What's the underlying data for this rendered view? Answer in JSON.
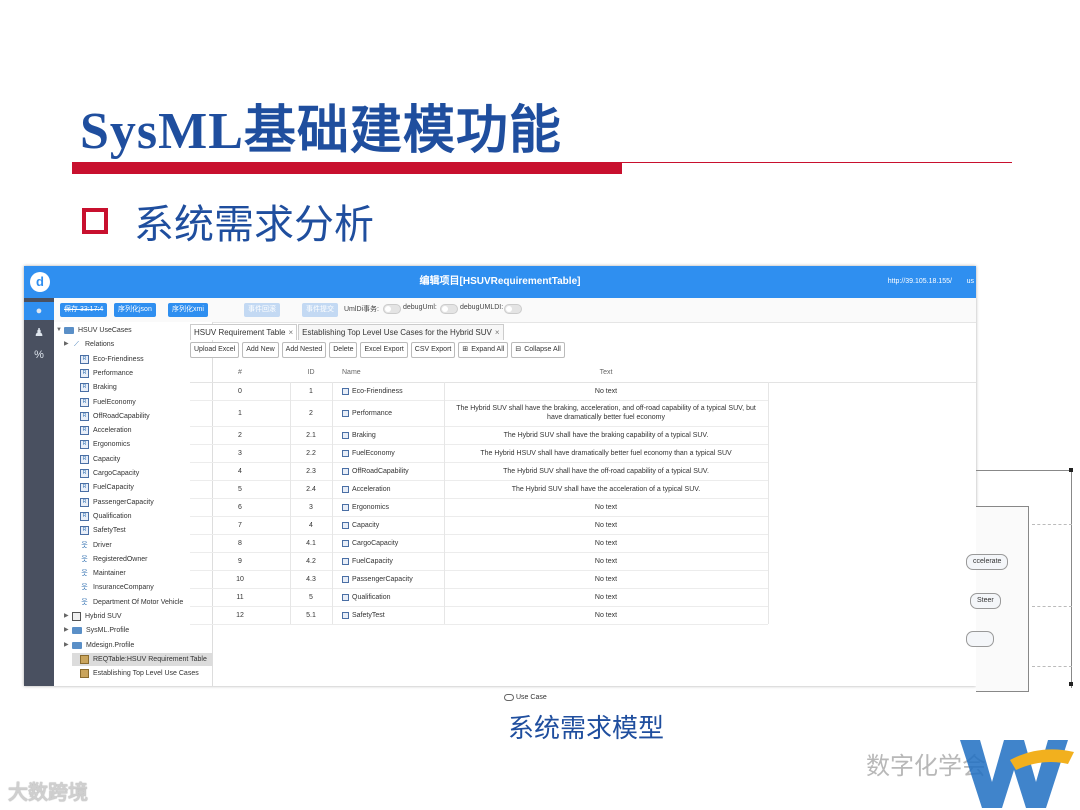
{
  "slide": {
    "title": "SysML基础建模功能",
    "subtitle": "系统需求分析",
    "caption": "系统需求模型",
    "watermark_left": "大数跨境",
    "watermark_right": "数字化学会"
  },
  "app": {
    "logo": "d",
    "window_title": "编辑项目[HSUVRequirementTable]",
    "url": "http://39.105.18.155/",
    "user": "us"
  },
  "toolbar": {
    "save_label": "保存 33:17:4",
    "json_label": "序列化json",
    "xmi_label": "序列化xmi",
    "disabled1": "事件回滚",
    "disabled2": "事件提交",
    "switch1_label": "UmlDi事务:",
    "switch2_label": "debugUml:",
    "switch3_label": "debugUMLDI:"
  },
  "tree": {
    "items": [
      {
        "label": "HSUV UseCases",
        "arrow": "▼",
        "icon": "folder"
      },
      {
        "label": "Relations",
        "arrow": "▶",
        "icon": "rel"
      },
      {
        "label": "Eco-Friendiness",
        "arrow": "",
        "icon": "req"
      },
      {
        "label": "Performance",
        "arrow": "",
        "icon": "req"
      },
      {
        "label": "Braking",
        "arrow": "",
        "icon": "req"
      },
      {
        "label": "FuelEconomy",
        "arrow": "",
        "icon": "req"
      },
      {
        "label": "OffRoadCapability",
        "arrow": "",
        "icon": "req"
      },
      {
        "label": "Acceleration",
        "arrow": "",
        "icon": "req"
      },
      {
        "label": "Ergonomics",
        "arrow": "",
        "icon": "req"
      },
      {
        "label": "Capacity",
        "arrow": "",
        "icon": "req"
      },
      {
        "label": "CargoCapacity",
        "arrow": "",
        "icon": "req"
      },
      {
        "label": "FuelCapacity",
        "arrow": "",
        "icon": "req"
      },
      {
        "label": "PassengerCapacity",
        "arrow": "",
        "icon": "req"
      },
      {
        "label": "Qualification",
        "arrow": "",
        "icon": "req"
      },
      {
        "label": "SafetyTest",
        "arrow": "",
        "icon": "req"
      },
      {
        "label": "Driver",
        "arrow": "",
        "icon": "actor"
      },
      {
        "label": "RegisteredOwner",
        "arrow": "",
        "icon": "actor"
      },
      {
        "label": "Maintainer",
        "arrow": "",
        "icon": "actor"
      },
      {
        "label": "InsuranceCompany",
        "arrow": "",
        "icon": "actor"
      },
      {
        "label": "Department Of Motor Vehicle",
        "arrow": "",
        "icon": "actor"
      },
      {
        "label": "Hybrid SUV",
        "arrow": "▶",
        "icon": "pkg"
      },
      {
        "label": "SysML.Profile",
        "arrow": "▶",
        "icon": "folder"
      },
      {
        "label": "Mdesign.Profile",
        "arrow": "▶",
        "icon": "folder"
      },
      {
        "label": "REQTable:HSUV Requirement Table",
        "arrow": "",
        "icon": "table"
      },
      {
        "label": "Establishing Top Level Use Cases",
        "arrow": "",
        "icon": "table"
      }
    ]
  },
  "tabs": [
    {
      "label": "HSUV Requirement Table",
      "close": "×"
    },
    {
      "label": "Establishing Top Level Use Cases for the Hybrid SUV",
      "close": "×"
    }
  ],
  "actions": [
    {
      "label": "Upload Excel",
      "icon": ""
    },
    {
      "label": "Add New",
      "icon": ""
    },
    {
      "label": "Add Nested",
      "icon": ""
    },
    {
      "label": "Delete",
      "icon": ""
    },
    {
      "label": "Excel Export",
      "icon": ""
    },
    {
      "label": "CSV Export",
      "icon": ""
    },
    {
      "label": "Expand All",
      "icon": "expand-icon"
    },
    {
      "label": "Collapse All",
      "icon": "collapse-icon"
    }
  ],
  "table": {
    "headers": [
      "#",
      "ID",
      "Name",
      "Text"
    ],
    "rows": [
      {
        "num": "0",
        "id": "1",
        "name": "Eco-Friendiness",
        "text": "No text"
      },
      {
        "num": "1",
        "id": "2",
        "name": "Performance",
        "text": "The Hybrid SUV shall have the braking, acceleration, and off-road capability of a typical SUV, but have dramatically better fuel economy"
      },
      {
        "num": "2",
        "id": "2.1",
        "name": "Braking",
        "text": "The Hybrid SUV shall have the braking capability of a typical SUV."
      },
      {
        "num": "3",
        "id": "2.2",
        "name": "FuelEconomy",
        "text": "The Hybrid HSUV shall have dramatically better fuel economy than a typical SUV"
      },
      {
        "num": "4",
        "id": "2.3",
        "name": "OffRoadCapability",
        "text": "The Hybrid SUV shall have the off-road capability of a typical SUV."
      },
      {
        "num": "5",
        "id": "2.4",
        "name": "Acceleration",
        "text": "The Hybrid SUV shall have the acceleration of a typical SUV."
      },
      {
        "num": "6",
        "id": "3",
        "name": "Ergonomics",
        "text": "No text"
      },
      {
        "num": "7",
        "id": "4",
        "name": "Capacity",
        "text": "No text"
      },
      {
        "num": "8",
        "id": "4.1",
        "name": "CargoCapacity",
        "text": "No text"
      },
      {
        "num": "9",
        "id": "4.2",
        "name": "FuelCapacity",
        "text": "No text"
      },
      {
        "num": "10",
        "id": "4.3",
        "name": "PassengerCapacity",
        "text": "No text"
      },
      {
        "num": "11",
        "id": "5",
        "name": "Qualification",
        "text": "No text"
      },
      {
        "num": "12",
        "id": "5.1",
        "name": "SafetyTest",
        "text": "No text"
      }
    ]
  },
  "diagram_peek": {
    "oval1": "ccelerate",
    "oval2": "Steer",
    "legend": "Use Case"
  },
  "colors": {
    "accent": "#2f8ff0",
    "title_blue": "#1f4e9e",
    "red": "#c8102e",
    "rail": "#495060"
  }
}
